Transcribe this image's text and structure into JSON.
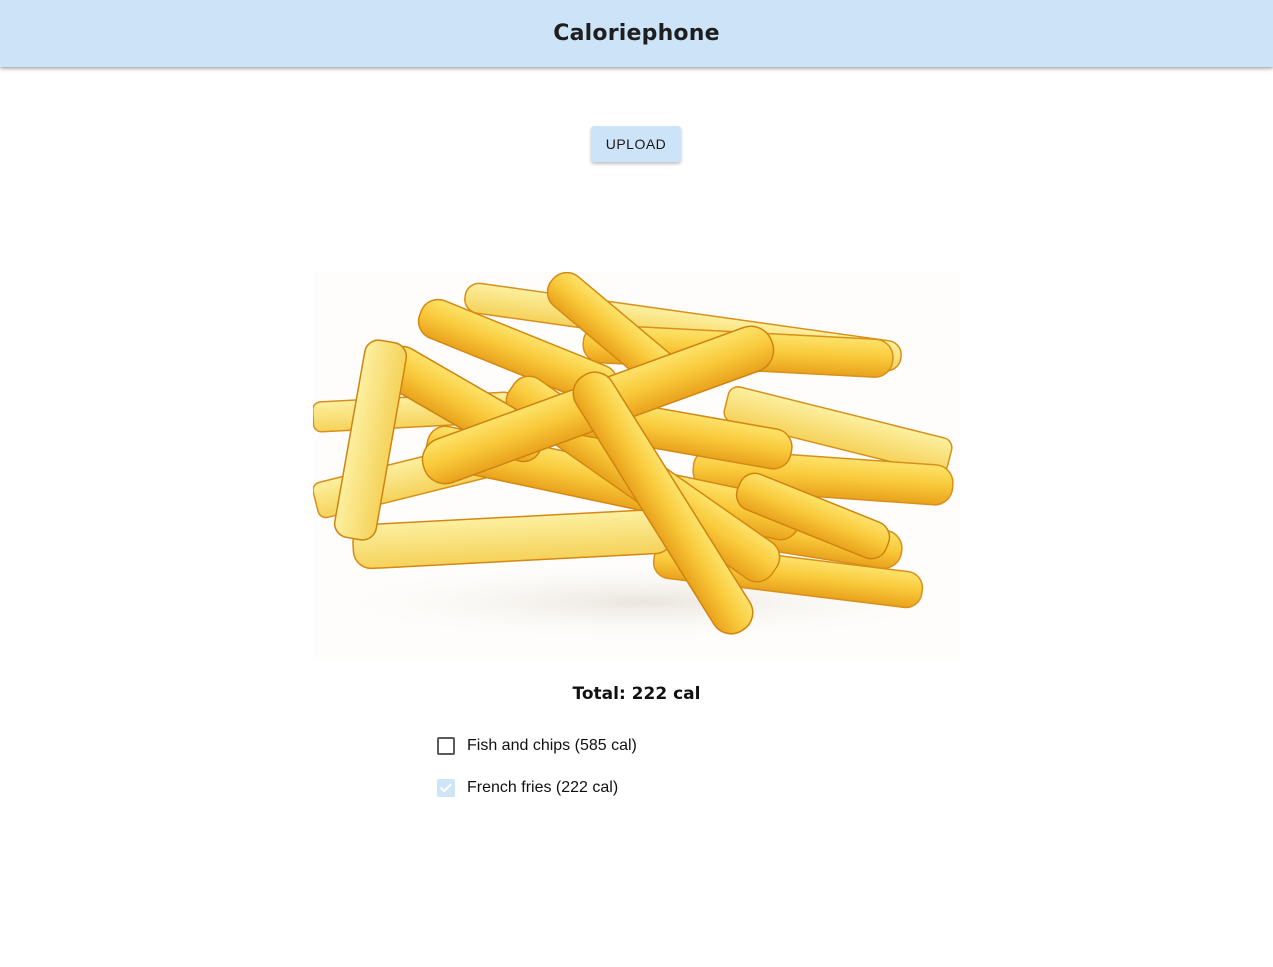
{
  "app": {
    "title": "Caloriephone"
  },
  "actions": {
    "upload_label": "UPLOAD"
  },
  "summary": {
    "total_label": "Total: 222 cal"
  },
  "colors": {
    "accent": "#cce3f8",
    "checked_box": "#cfe4f7"
  },
  "image": {
    "icon": "french-fries-photo"
  },
  "predictions": [
    {
      "label": "Fish and chips (585 cal)",
      "checked": false
    },
    {
      "label": "French fries (222 cal)",
      "checked": true
    }
  ]
}
